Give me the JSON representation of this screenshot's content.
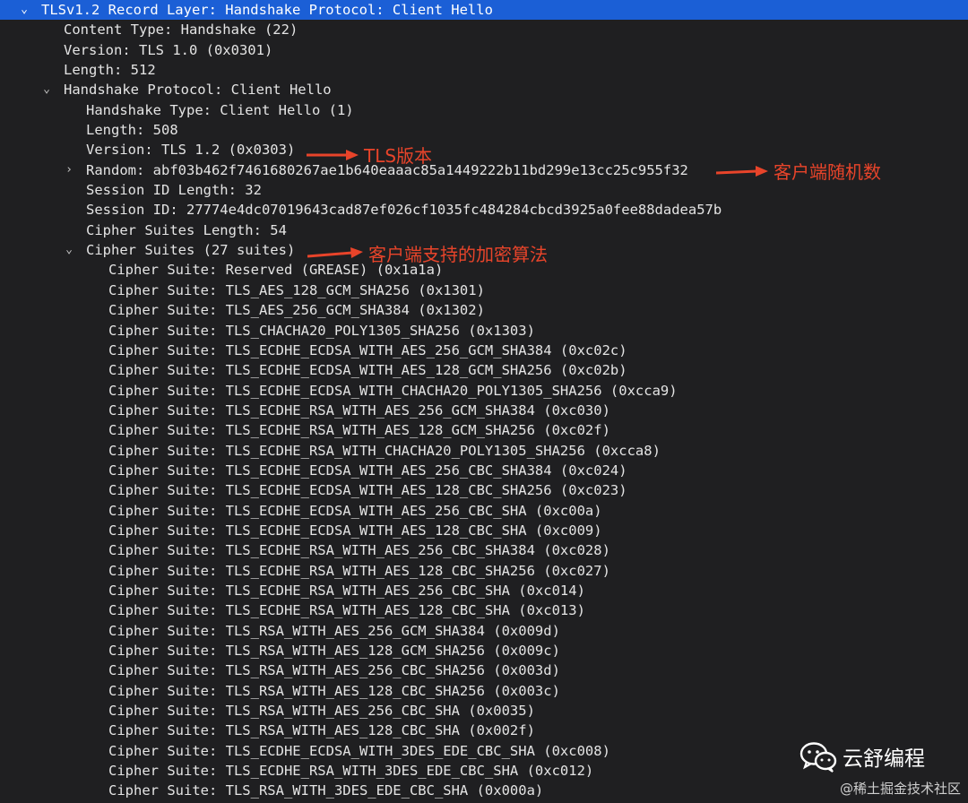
{
  "tree": {
    "record_layer": "TLSv1.2 Record Layer: Handshake Protocol: Client Hello",
    "content_type": "Content Type: Handshake (22)",
    "record_version": "Version: TLS 1.0 (0x0301)",
    "record_length": "Length: 512",
    "handshake_protocol": "Handshake Protocol: Client Hello",
    "handshake_type": "Handshake Type: Client Hello (1)",
    "handshake_length": "Length: 508",
    "handshake_version": "Version: TLS 1.2 (0x0303)",
    "random": "Random: abf03b462f7461680267ae1b640eaaac85a1449222b11bd299e13cc25c955f32",
    "session_id_length": "Session ID Length: 32",
    "session_id": "Session ID: 27774e4dc07019643cad87ef026cf1035fc484284cbcd3925a0fee88dadea57b",
    "cipher_suites_length": "Cipher Suites Length: 54",
    "cipher_suites": "Cipher Suites (27 suites)",
    "cipher_suite_items": [
      "Cipher Suite: Reserved (GREASE) (0x1a1a)",
      "Cipher Suite: TLS_AES_128_GCM_SHA256 (0x1301)",
      "Cipher Suite: TLS_AES_256_GCM_SHA384 (0x1302)",
      "Cipher Suite: TLS_CHACHA20_POLY1305_SHA256 (0x1303)",
      "Cipher Suite: TLS_ECDHE_ECDSA_WITH_AES_256_GCM_SHA384 (0xc02c)",
      "Cipher Suite: TLS_ECDHE_ECDSA_WITH_AES_128_GCM_SHA256 (0xc02b)",
      "Cipher Suite: TLS_ECDHE_ECDSA_WITH_CHACHA20_POLY1305_SHA256 (0xcca9)",
      "Cipher Suite: TLS_ECDHE_RSA_WITH_AES_256_GCM_SHA384 (0xc030)",
      "Cipher Suite: TLS_ECDHE_RSA_WITH_AES_128_GCM_SHA256 (0xc02f)",
      "Cipher Suite: TLS_ECDHE_RSA_WITH_CHACHA20_POLY1305_SHA256 (0xcca8)",
      "Cipher Suite: TLS_ECDHE_ECDSA_WITH_AES_256_CBC_SHA384 (0xc024)",
      "Cipher Suite: TLS_ECDHE_ECDSA_WITH_AES_128_CBC_SHA256 (0xc023)",
      "Cipher Suite: TLS_ECDHE_ECDSA_WITH_AES_256_CBC_SHA (0xc00a)",
      "Cipher Suite: TLS_ECDHE_ECDSA_WITH_AES_128_CBC_SHA (0xc009)",
      "Cipher Suite: TLS_ECDHE_RSA_WITH_AES_256_CBC_SHA384 (0xc028)",
      "Cipher Suite: TLS_ECDHE_RSA_WITH_AES_128_CBC_SHA256 (0xc027)",
      "Cipher Suite: TLS_ECDHE_RSA_WITH_AES_256_CBC_SHA (0xc014)",
      "Cipher Suite: TLS_ECDHE_RSA_WITH_AES_128_CBC_SHA (0xc013)",
      "Cipher Suite: TLS_RSA_WITH_AES_256_GCM_SHA384 (0x009d)",
      "Cipher Suite: TLS_RSA_WITH_AES_128_GCM_SHA256 (0x009c)",
      "Cipher Suite: TLS_RSA_WITH_AES_256_CBC_SHA256 (0x003d)",
      "Cipher Suite: TLS_RSA_WITH_AES_128_CBC_SHA256 (0x003c)",
      "Cipher Suite: TLS_RSA_WITH_AES_256_CBC_SHA (0x0035)",
      "Cipher Suite: TLS_RSA_WITH_AES_128_CBC_SHA (0x002f)",
      "Cipher Suite: TLS_ECDHE_ECDSA_WITH_3DES_EDE_CBC_SHA (0xc008)",
      "Cipher Suite: TLS_ECDHE_RSA_WITH_3DES_EDE_CBC_SHA (0xc012)",
      "Cipher Suite: TLS_RSA_WITH_3DES_EDE_CBC_SHA (0x000a)"
    ]
  },
  "annotations": {
    "tls_version": "TLS版本",
    "client_random": "客户端随机数",
    "client_ciphers": "客户端支持的加密算法"
  },
  "watermark": {
    "account": "云舒编程",
    "site": "@稀土掘金技术社区",
    "icon": "wechat-icon"
  },
  "colors": {
    "background": "#1f1f21",
    "selection": "#1b5fd6",
    "annotation": "#e8442a",
    "text": "#e4e4e4"
  }
}
